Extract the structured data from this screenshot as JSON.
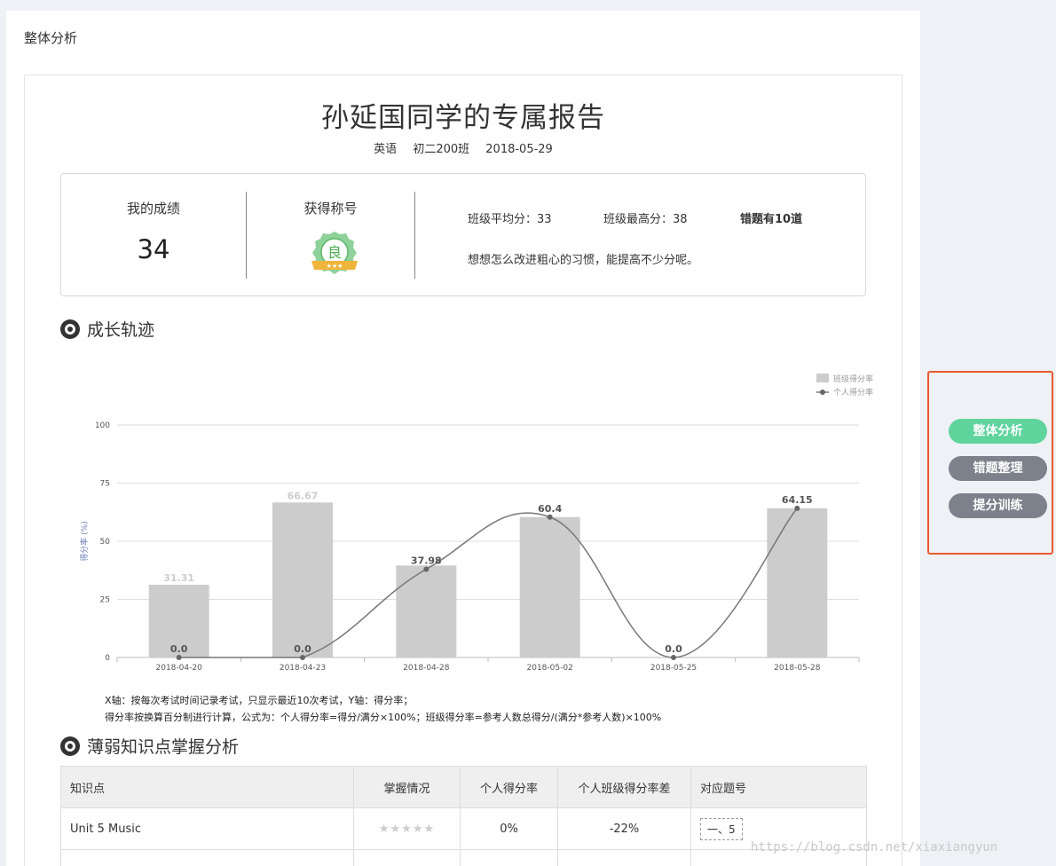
{
  "page": {
    "heading": "整体分析"
  },
  "report": {
    "title": "孙延国同学的专属报告",
    "subject": "英语",
    "class": "初二200班",
    "date": "2018-05-29"
  },
  "summary": {
    "my_score_label": "我的成绩",
    "my_score": "34",
    "title_label": "获得称号",
    "badge_char": "良",
    "class_avg": "班级平均分：33",
    "class_max": "班级最高分：38",
    "wrong_count": "错题有10道",
    "tip": "想想怎么改进粗心的习惯，能提高不少分呢。"
  },
  "growth": {
    "section_title": "成长轨迹",
    "note_line1": "X轴：按每次考试时间记录考试，只显示最近10次考试，Y轴：得分率；",
    "note_line2": "得分率按换算百分制进行计算，公式为：个人得分率=得分/满分×100%；班级得分率=参考人数总得分/(满分*参考人数)×100%"
  },
  "chart_data": {
    "type": "bar",
    "categories": [
      "2018-04-20",
      "2018-04-23",
      "2018-04-28",
      "2018-05-02",
      "2018-05-25",
      "2018-05-28"
    ],
    "series": [
      {
        "name": "班级得分率",
        "type": "bar",
        "values": [
          31.31,
          66.67,
          39.58,
          60.4,
          0.0,
          64.15
        ],
        "labels": [
          "31.31",
          "66.67",
          "",
          "",
          "",
          ""
        ],
        "color": "#cccccc"
      },
      {
        "name": "个人得分率",
        "type": "line",
        "values": [
          0.0,
          0.0,
          37.98,
          60.4,
          0.0,
          64.15
        ],
        "labels": [
          "0.0",
          "0.0",
          "37.98",
          "60.4",
          "0.0",
          "64.15"
        ],
        "color": "#777777"
      }
    ],
    "ylabel": "得分率 (%)",
    "ylim": [
      0,
      100
    ],
    "yticks": [
      0,
      25,
      50,
      75,
      100
    ],
    "grid": true,
    "legend": "top-right"
  },
  "weak": {
    "section_title": "薄弱知识点掌握分析",
    "headers": [
      "知识点",
      "掌握情况",
      "个人得分率",
      "个人班级得分率差",
      "对应题号"
    ],
    "rows": [
      {
        "topic": "Unit 5 Music",
        "stars": "★★★★★",
        "personal_rate": "0%",
        "diff": "-22%",
        "questions": [
          "一、5"
        ]
      }
    ]
  },
  "side_nav": {
    "items": [
      "整体分析",
      "错题整理",
      "提分训练"
    ],
    "active": 0,
    "colors": {
      "active": "#5fd49d",
      "inactive": "#7c818b",
      "border": "#e85a2c"
    }
  },
  "watermark": "https://blog.csdn.net/xiaxiangyun"
}
